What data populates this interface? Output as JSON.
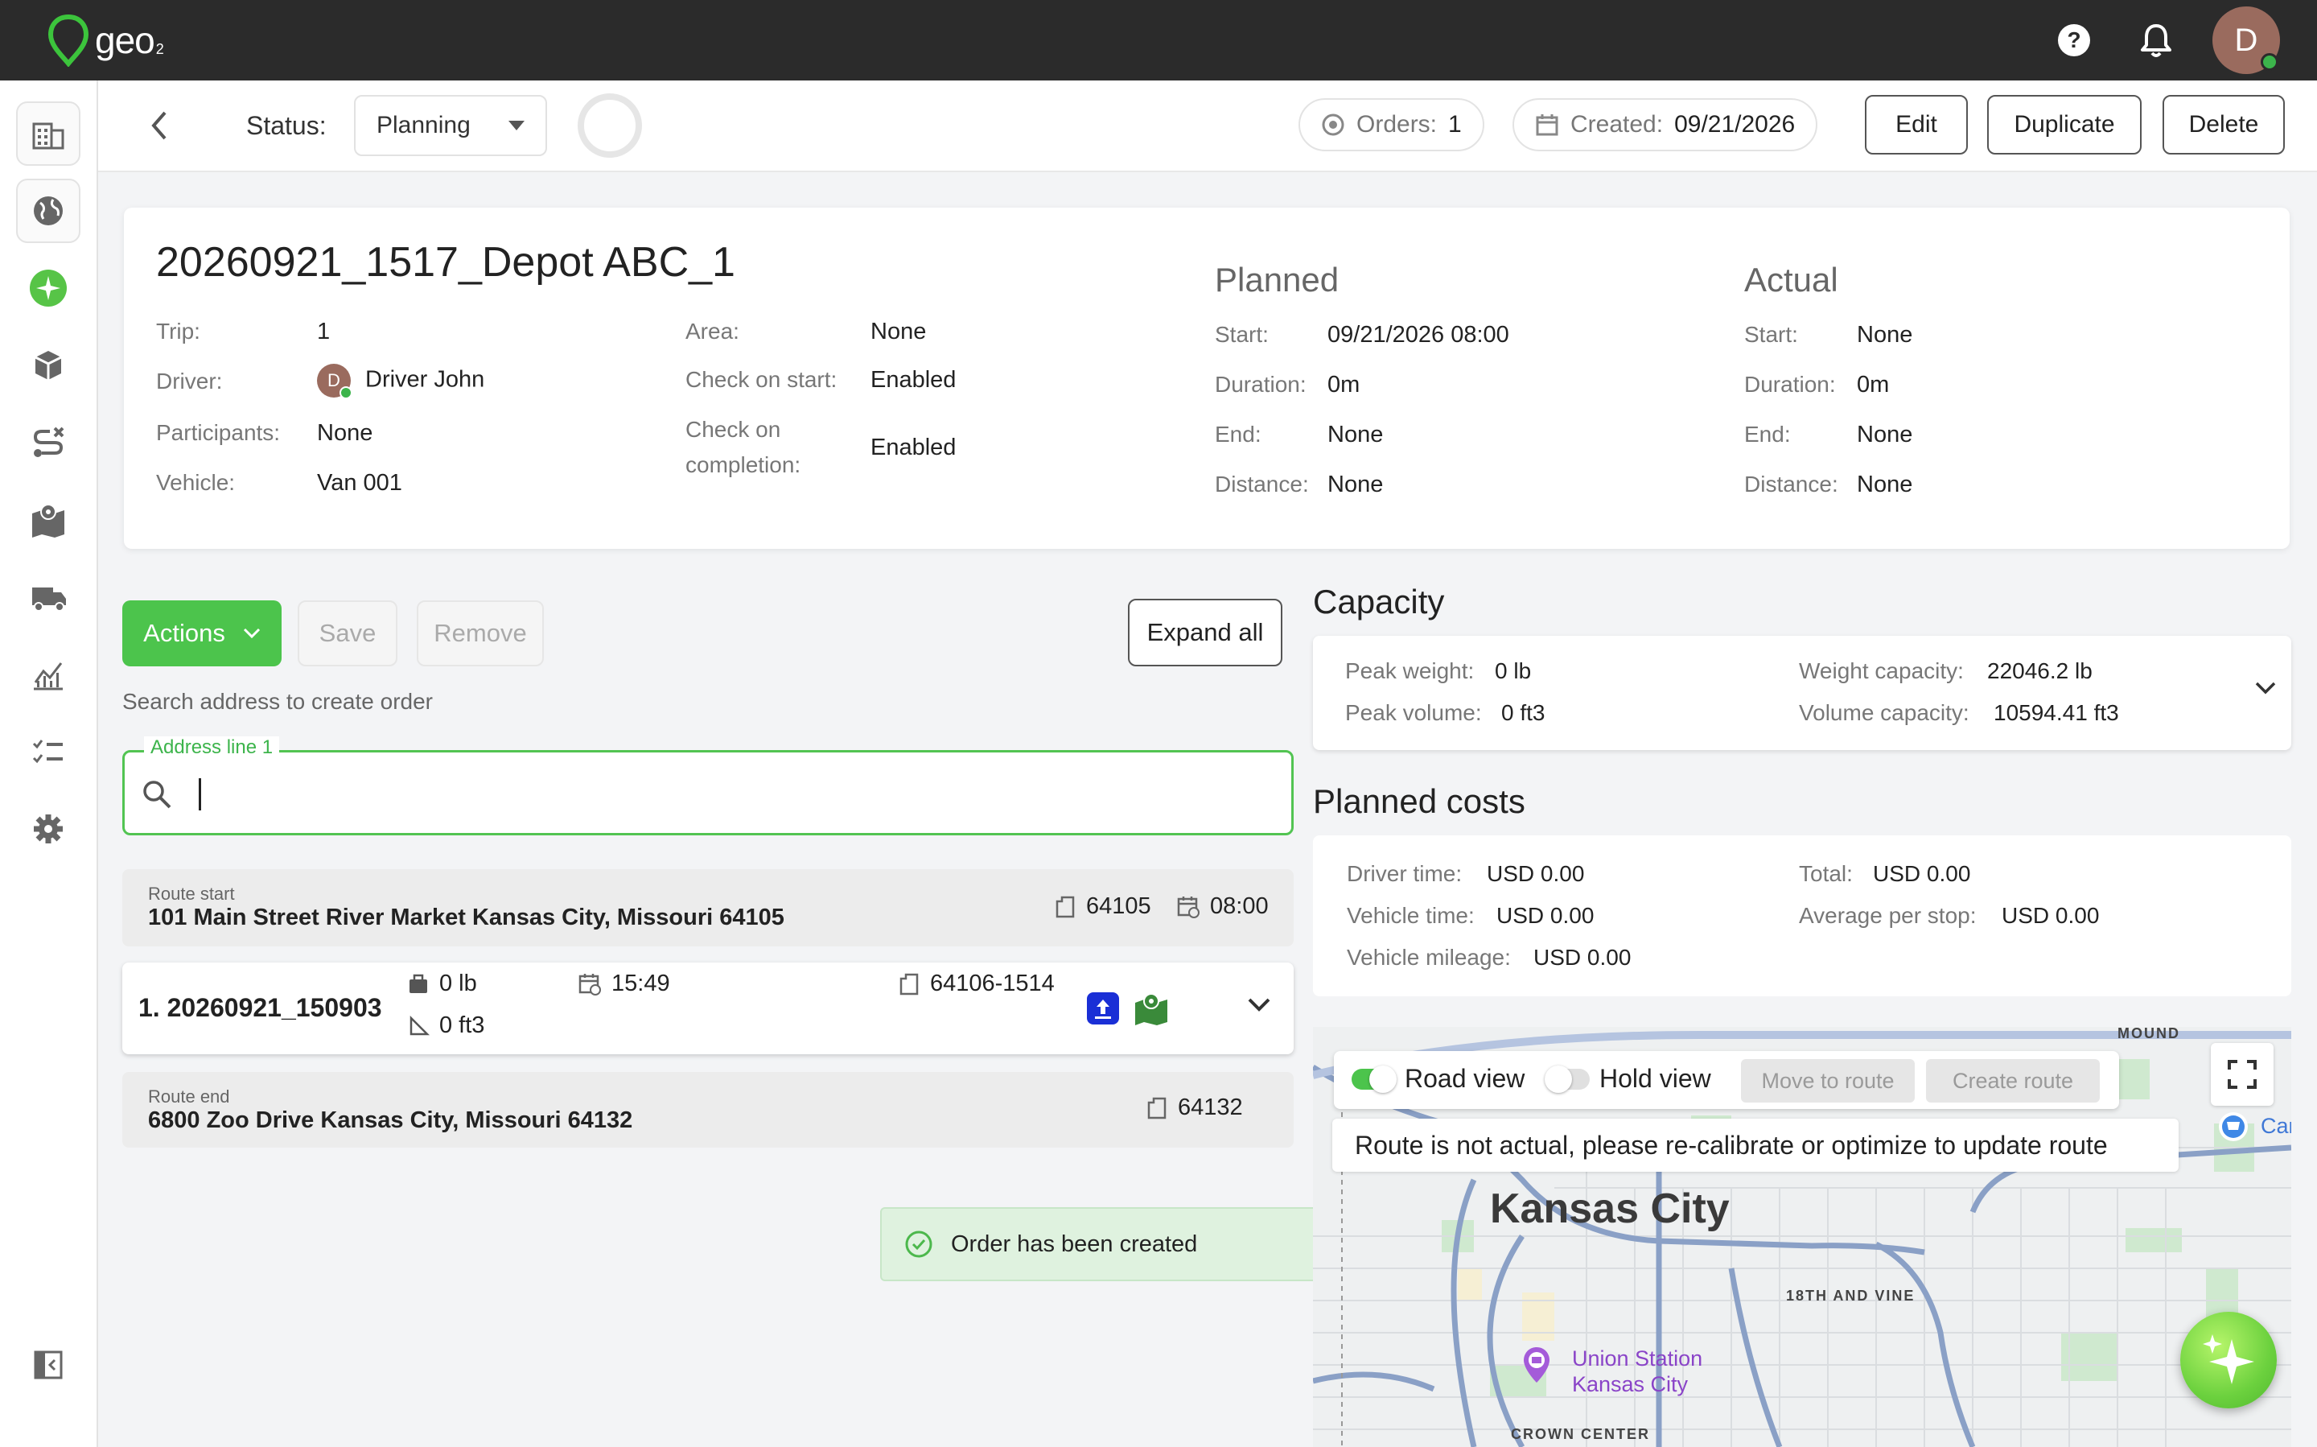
{
  "app": {
    "logo_text": "geo",
    "logo_sub": "2",
    "user_initial": "D"
  },
  "header": {
    "status_label": "Status:",
    "status_value": "Planning",
    "orders_label": "Orders:",
    "orders_value": "1",
    "created_label": "Created:",
    "created_value": "09/21/2026",
    "edit": "Edit",
    "duplicate": "Duplicate",
    "delete": "Delete"
  },
  "trip": {
    "title": "20260921_1517_Depot ABC_1",
    "fields": {
      "trip_label": "Trip:",
      "trip_value": "1",
      "driver_label": "Driver:",
      "driver_initial": "D",
      "driver_value": "Driver John",
      "participants_label": "Participants:",
      "participants_value": "None",
      "vehicle_label": "Vehicle:",
      "vehicle_value": "Van 001",
      "area_label": "Area:",
      "area_value": "None",
      "check_start_label": "Check on start:",
      "check_start_value": "Enabled",
      "check_completion_label_1": "Check on",
      "check_completion_label_2": "completion:",
      "check_completion_value": "Enabled"
    },
    "planned": {
      "heading": "Planned",
      "start_label": "Start:",
      "start_value": "09/21/2026 08:00",
      "duration_label": "Duration:",
      "duration_value": "0m",
      "end_label": "End:",
      "end_value": "None",
      "distance_label": "Distance:",
      "distance_value": "None"
    },
    "actual": {
      "heading": "Actual",
      "start_label": "Start:",
      "start_value": "None",
      "duration_label": "Duration:",
      "duration_value": "0m",
      "end_label": "End:",
      "end_value": "None",
      "distance_label": "Distance:",
      "distance_value": "None"
    }
  },
  "toolbar": {
    "actions": "Actions",
    "save": "Save",
    "remove": "Remove",
    "expand_all": "Expand all",
    "search_hint": "Search address to create order",
    "address_legend": "Address line 1",
    "address_value": ""
  },
  "route": {
    "start_label": "Route start",
    "start_address": "101 Main Street River Market Kansas City, Missouri 64105",
    "start_zip": "64105",
    "start_time": "08:00",
    "order_title": "1. 20260921_150903",
    "order_weight": "0 lb",
    "order_volume": "0 ft3",
    "order_time": "15:49",
    "order_zip": "64106-1514",
    "end_label": "Route end",
    "end_address": "6800 Zoo Drive Kansas City, Missouri 64132",
    "end_zip": "64132"
  },
  "toast": {
    "message": "Order has been created"
  },
  "capacity": {
    "heading": "Capacity",
    "peak_weight_label": "Peak weight:",
    "peak_weight_value": "0 lb",
    "peak_volume_label": "Peak volume:",
    "peak_volume_value": "0 ft3",
    "weight_capacity_label": "Weight capacity:",
    "weight_capacity_value": "22046.2 lb",
    "volume_capacity_label": "Volume capacity:",
    "volume_capacity_value": "10594.41 ft3"
  },
  "costs": {
    "heading": "Planned costs",
    "driver_time_label": "Driver time:",
    "driver_time_value": "USD 0.00",
    "vehicle_time_label": "Vehicle time:",
    "vehicle_time_value": "USD 0.00",
    "vehicle_mileage_label": "Vehicle mileage:",
    "vehicle_mileage_value": "USD 0.00",
    "total_label": "Total:",
    "total_value": "USD 0.00",
    "avg_stop_label": "Average per stop:",
    "avg_stop_value": "USD 0.00"
  },
  "map": {
    "road_view": "Road view",
    "road_view_on": true,
    "hold_view": "Hold view",
    "hold_view_on": false,
    "move_to_route": "Move to route",
    "create_route": "Create route",
    "warning": "Route is not actual, please re-calibrate or optimize to update route",
    "city": "Kansas City",
    "district_1": "18TH AND VINE",
    "district_2": "CROWN CENTER",
    "district_3": "MOUND",
    "poi_line_1": "Union Station",
    "poi_line_2": "Kansas City",
    "edge_label": "Car"
  },
  "colors": {
    "accent": "#4cc44c",
    "topbar": "#2b2b2b",
    "avatar": "#9a6b5e",
    "order_badge": "#1a2fd6",
    "map_icon": "#3a8a3a"
  }
}
